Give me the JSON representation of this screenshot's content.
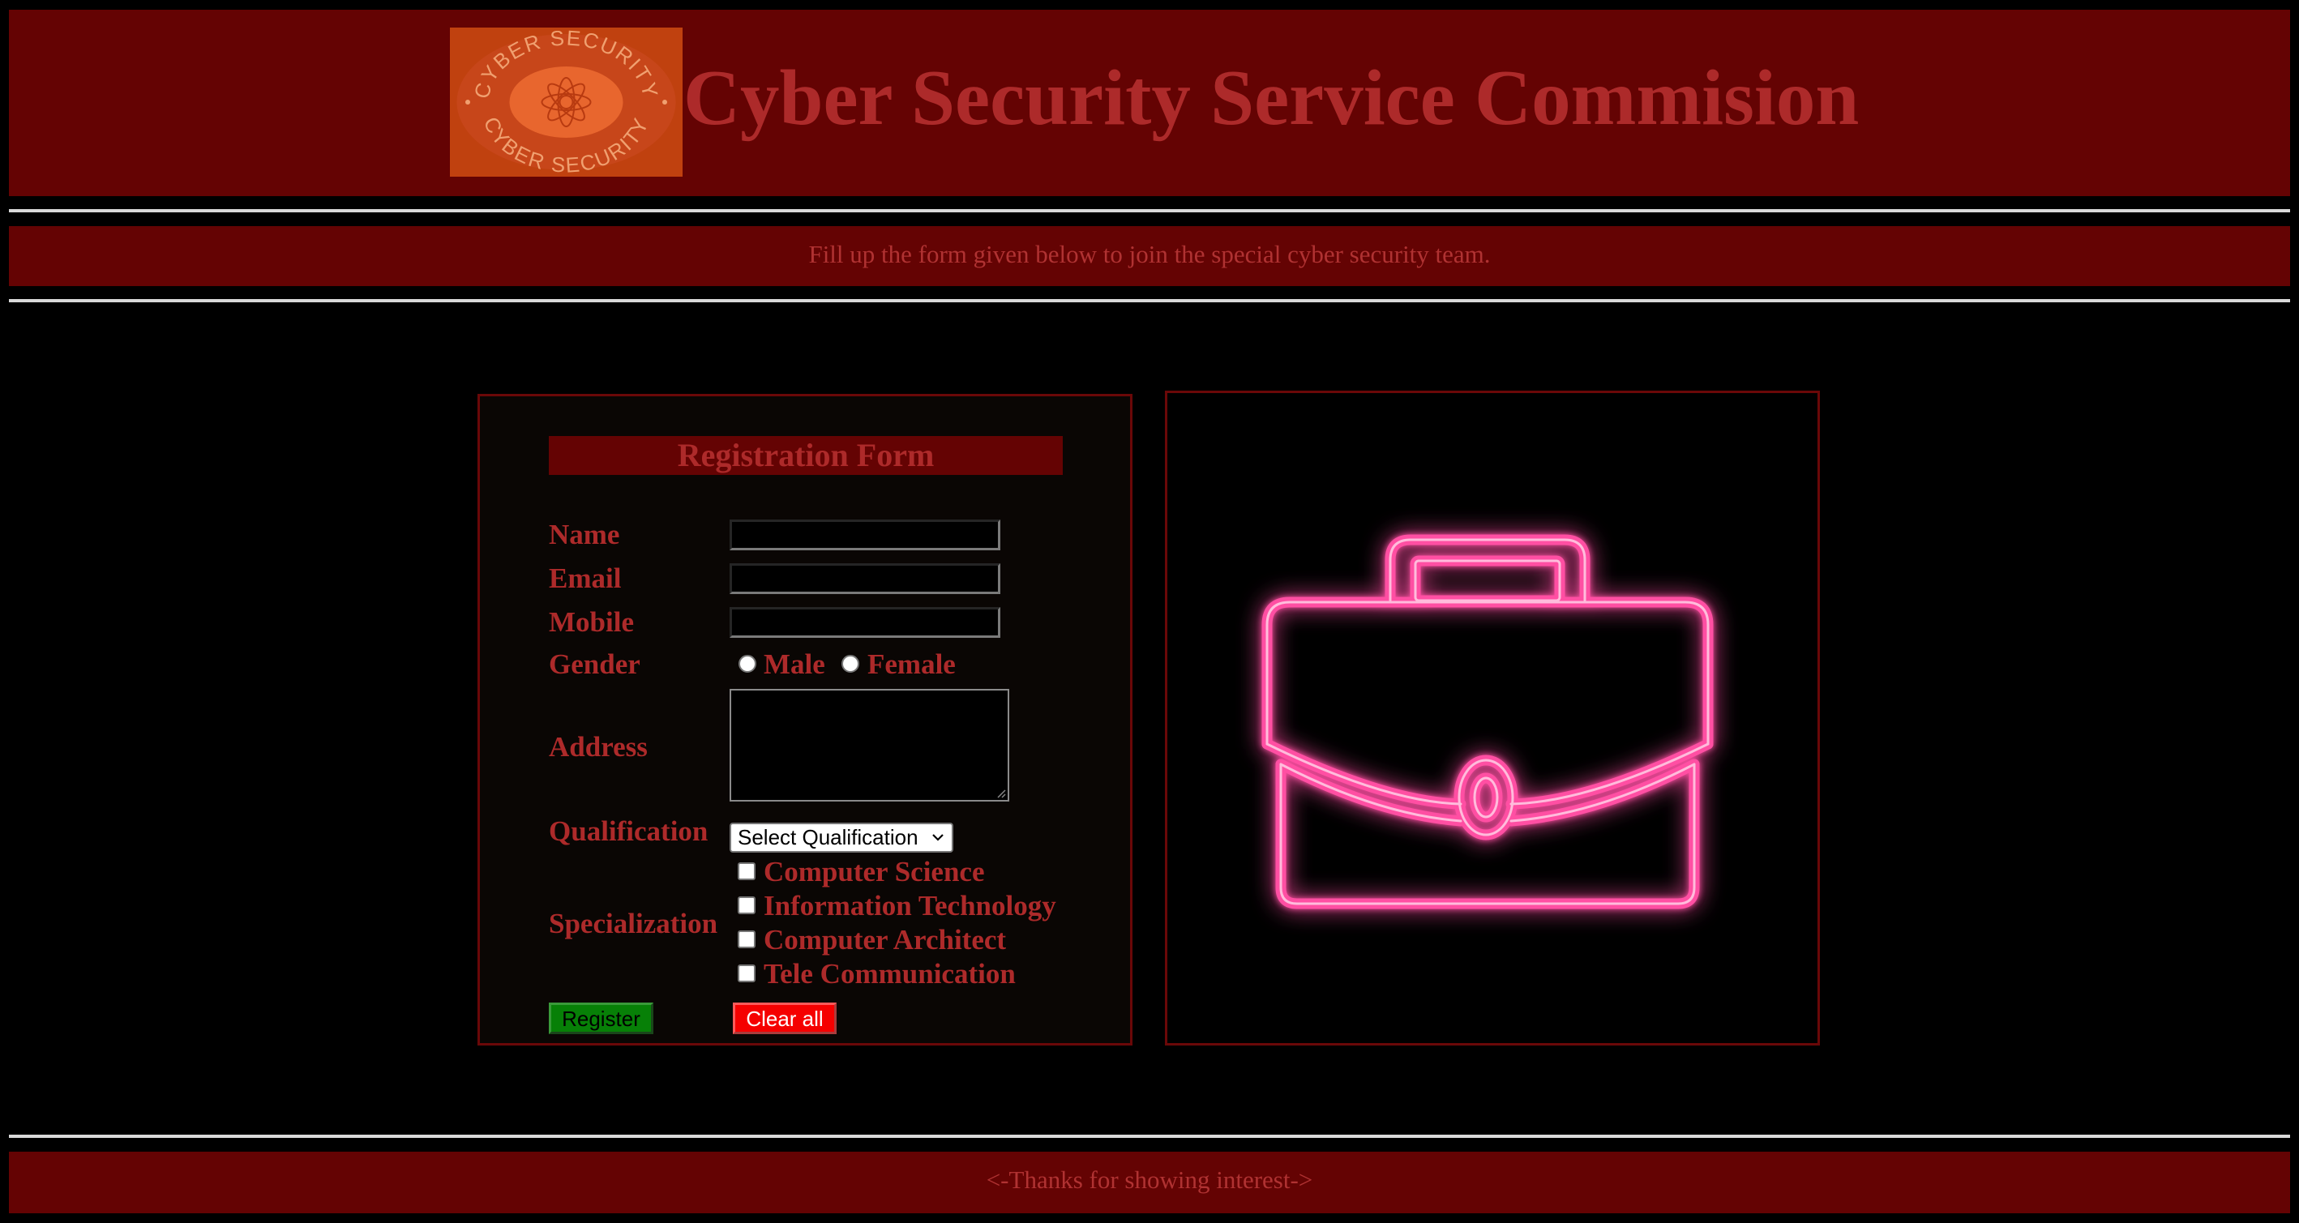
{
  "header": {
    "logo_text": "CYBER SECURITY",
    "title": "Cyber Security Service Commision"
  },
  "subheader": {
    "text": "Fill up the form given below to join the special cyber security team."
  },
  "form": {
    "title": "Registration Form",
    "fields": {
      "name_label": "Name",
      "name_value": "",
      "email_label": "Email",
      "email_value": "",
      "mobile_label": "Mobile",
      "mobile_value": "",
      "gender_label": "Gender",
      "gender_options": [
        "Male",
        "Female"
      ],
      "address_label": "Address",
      "address_value": "",
      "qualification_label": "Qualification",
      "qualification_selected": "Select Qualification",
      "specialization_label": "Specialization",
      "specialization_options": [
        "Computer Science",
        "Information Technology",
        "Computer Architect",
        "Tele Communication"
      ]
    },
    "buttons": {
      "register": "Register",
      "clear": "Clear all"
    }
  },
  "image_panel": {
    "icon": "briefcase-icon",
    "glow_color": "#ff4fa3"
  },
  "footer": {
    "text": "<-Thanks for showing interest->"
  },
  "colors": {
    "band": "#640303",
    "text_red": "#ad2a2a",
    "register_green": "#078007",
    "clear_red": "#f50000"
  }
}
